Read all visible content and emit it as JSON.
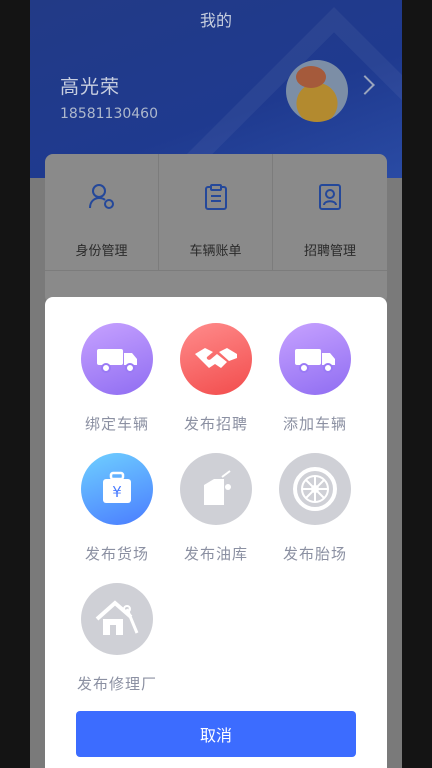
{
  "header": {
    "title": "我的",
    "user_name": "高光荣",
    "user_phone": "18581130460"
  },
  "grid": {
    "items": [
      {
        "label": "身份管理",
        "icon": "user-settings-icon"
      },
      {
        "label": "车辆账单",
        "icon": "clipboard-icon"
      },
      {
        "label": "招聘管理",
        "icon": "profile-card-icon"
      }
    ]
  },
  "sheet": {
    "items": [
      {
        "label": "绑定车辆",
        "icon": "truck-icon",
        "color": "#a884ff"
      },
      {
        "label": "发布招聘",
        "icon": "handshake-icon",
        "color": "#f25f5f"
      },
      {
        "label": "添加车辆",
        "icon": "truck-icon",
        "color": "#a884ff"
      },
      {
        "label": "发布货场",
        "icon": "yen-bag-icon",
        "color": "#4a7cff"
      },
      {
        "label": "发布油库",
        "icon": "oil-can-icon",
        "color": "#cfd0d6"
      },
      {
        "label": "发布胎场",
        "icon": "tire-icon",
        "color": "#cfd0d6"
      },
      {
        "label": "发布修理厂",
        "icon": "repair-house-icon",
        "color": "#cfd0d6"
      }
    ],
    "cancel_label": "取消"
  },
  "colors": {
    "header_blue": "#223a86",
    "accent_blue": "#3c6cff",
    "label_gray": "#8b90a2"
  }
}
